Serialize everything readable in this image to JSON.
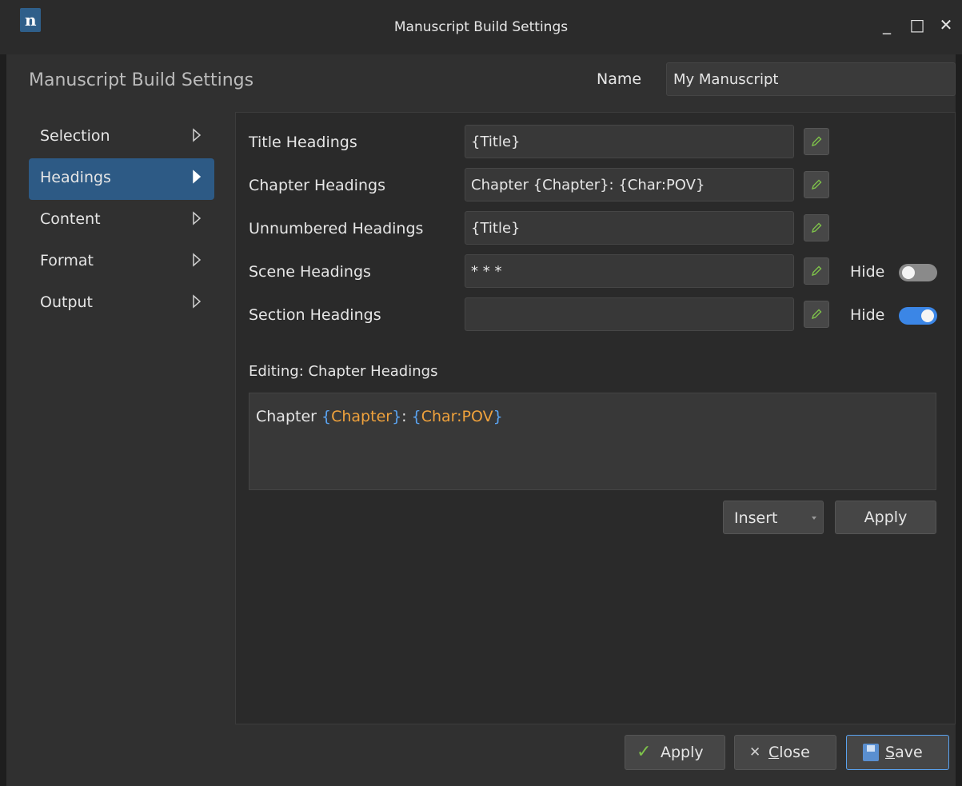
{
  "window": {
    "title": "Manuscript Build Settings",
    "logo_letter": "n",
    "minimize": "_",
    "maximize": "□",
    "close": "✕"
  },
  "header": {
    "title": "Manuscript Build Settings",
    "name_label": "Name",
    "name_value": "My Manuscript"
  },
  "nav": {
    "items": [
      {
        "label": "Selection",
        "active": false
      },
      {
        "label": "Headings",
        "active": true
      },
      {
        "label": "Content",
        "active": false
      },
      {
        "label": "Format",
        "active": false
      },
      {
        "label": "Output",
        "active": false
      }
    ]
  },
  "headings": {
    "rows": [
      {
        "label": "Title Headings",
        "value": "{Title}"
      },
      {
        "label": "Chapter Headings",
        "value": "Chapter {Chapter}: {Char:POV}"
      },
      {
        "label": "Unnumbered Headings",
        "value": "{Title}"
      },
      {
        "label": "Scene Headings",
        "value": "* * *",
        "hide_label": "Hide",
        "hide": false
      },
      {
        "label": "Section Headings",
        "value": "",
        "hide_label": "Hide",
        "hide": true
      }
    ]
  },
  "editor": {
    "label": "Editing: Chapter Headings",
    "parts": {
      "p1": "Chapter ",
      "b1": "{",
      "t1": "Chapter",
      "b2": "}",
      "p2": ": ",
      "b3": "{",
      "t2": "Char:POV",
      "b4": "}"
    },
    "insert_label": "Insert",
    "apply_label": "Apply"
  },
  "footer": {
    "apply_icon": "✓",
    "apply_label": "Apply",
    "close_icon": "✕",
    "close_label_first": "C",
    "close_label_rest": "lose",
    "save_label_first": "S",
    "save_label_rest": "ave"
  },
  "colors": {
    "accent": "#2d5a85",
    "toggle_on": "#3b86e6",
    "token_brace": "#5aa3f0",
    "token_name": "#f0a23c",
    "apply_check": "#7ec24a"
  }
}
